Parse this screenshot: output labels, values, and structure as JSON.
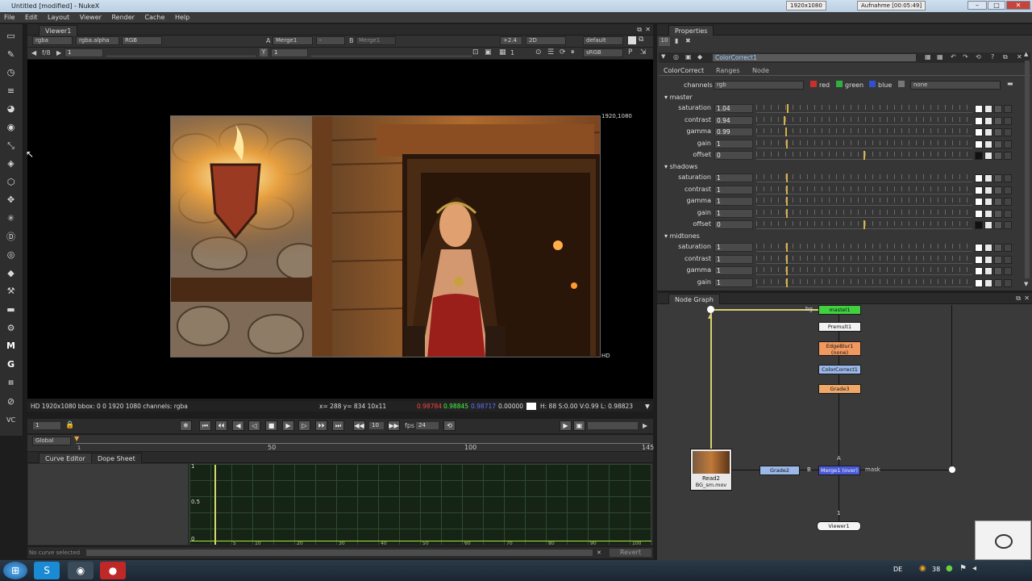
{
  "window": {
    "title": "Untitled [modified] - NukeX",
    "recording": "1920x1080",
    "recording_label": "Aufnahme [00:05:49]"
  },
  "menu": [
    "File",
    "Edit",
    "Layout",
    "Viewer",
    "Render",
    "Cache",
    "Help"
  ],
  "viewer": {
    "tab": "Viewer1",
    "channels": "rgba",
    "alpha": "rgba.alpha",
    "colorspace": "RGB",
    "a_input": "Merge1",
    "b_input": "Merge1",
    "op": "-",
    "gain": "+2.4",
    "mode": "2D",
    "lut": "default",
    "lut2": "sRGB",
    "fstop": "f/8",
    "frame_field": "1",
    "y_label": "Y",
    "y_val": "1",
    "proxy": "1",
    "resolution_label": "1920,1080",
    "format_label": "HD",
    "info": "HD 1920x1080 bbox: 0 0 1920 1080 channels: rgba",
    "coords": "x= 288 y= 834   10x11",
    "r": "0.98784",
    "g": "0.98845",
    "b": "0.98717",
    "a": "0.00000",
    "hsv": "H: 88 S:0.00 V:0.99  L: 0.98823"
  },
  "playback": {
    "frame": "1",
    "step": "10",
    "fps_label": "fps",
    "fps": "24",
    "global": "Global",
    "ticks": [
      "1",
      "50",
      "100",
      "145"
    ]
  },
  "curve_editor": {
    "tabs": [
      "Curve Editor",
      "Dope Sheet"
    ],
    "yticks": [
      "1",
      "0.5",
      "0"
    ],
    "xticks": [
      "5",
      "10",
      "20",
      "30",
      "40",
      "50",
      "60",
      "70",
      "80",
      "90",
      "100"
    ],
    "status": "No curve selected",
    "revert": "Revert"
  },
  "properties": {
    "tab": "Properties",
    "count": "10",
    "node": "ColorCorrect1",
    "tabs": [
      "ColorCorrect",
      "Ranges",
      "Node"
    ],
    "channels_label": "channels",
    "channels": "rgb",
    "red": "red",
    "green": "green",
    "blue": "blue",
    "none": "none",
    "sections": [
      {
        "name": "master",
        "rows": [
          {
            "l": "saturation",
            "v": "1.04"
          },
          {
            "l": "contrast",
            "v": "0.94"
          },
          {
            "l": "gamma",
            "v": "0.99"
          },
          {
            "l": "gain",
            "v": "1"
          },
          {
            "l": "offset",
            "v": "0"
          }
        ]
      },
      {
        "name": "shadows",
        "rows": [
          {
            "l": "saturation",
            "v": "1"
          },
          {
            "l": "contrast",
            "v": "1"
          },
          {
            "l": "gamma",
            "v": "1"
          },
          {
            "l": "gain",
            "v": "1"
          },
          {
            "l": "offset",
            "v": "0"
          }
        ]
      },
      {
        "name": "midtones",
        "rows": [
          {
            "l": "saturation",
            "v": "1"
          },
          {
            "l": "contrast",
            "v": "1"
          },
          {
            "l": "gamma",
            "v": "1"
          },
          {
            "l": "gain",
            "v": "1"
          }
        ]
      }
    ],
    "slider_ticks": [
      "0",
      "0.1",
      "0.2",
      "0.3",
      "0.4",
      "0.5",
      "0.6",
      "0.7",
      "0.8",
      "1",
      "2",
      "3",
      "4"
    ]
  },
  "nodegraph": {
    "tab": "Node Graph",
    "nodes": {
      "master": "mastel1",
      "premult": "Premult1",
      "edge": "EdgeBlur1",
      "edge_sub": "(none)",
      "cc": "ColorCorrect1",
      "grade3": "Grade3",
      "grade2": "Grade2",
      "merge": "Merge1 (over)",
      "read": "Read2",
      "read_file": "BG_sm.mov",
      "viewer": "Viewer1"
    },
    "labels": {
      "bg": "bg",
      "b": "B",
      "a": "A",
      "mask": "mask",
      "one": "1"
    }
  },
  "taskbar": {
    "lang": "DE",
    "num": "38"
  }
}
